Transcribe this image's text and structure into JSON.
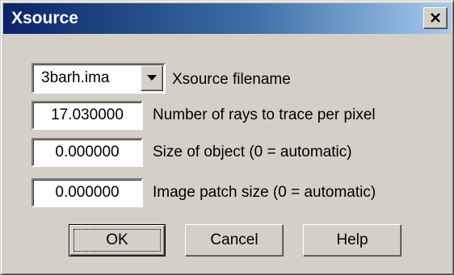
{
  "window": {
    "title": "Xsource"
  },
  "icons": {
    "close": "close-icon",
    "dropdown": "chevron-down-icon"
  },
  "colors": {
    "titlebar_start": "#0a246a",
    "titlebar_end": "#a6caf0",
    "dialog_face": "#d4d0c8"
  },
  "form": {
    "filename": {
      "value": "3barh.ima",
      "label": "Xsource filename"
    },
    "rays": {
      "value": "17.030000",
      "label": "Number of rays to trace per pixel"
    },
    "object_size": {
      "value": "0.000000",
      "label": "Size of object (0 = automatic)"
    },
    "patch_size": {
      "value": "0.000000",
      "label": "Image patch size (0 = automatic)"
    }
  },
  "buttons": {
    "ok": "OK",
    "cancel": "Cancel",
    "help": "Help"
  }
}
